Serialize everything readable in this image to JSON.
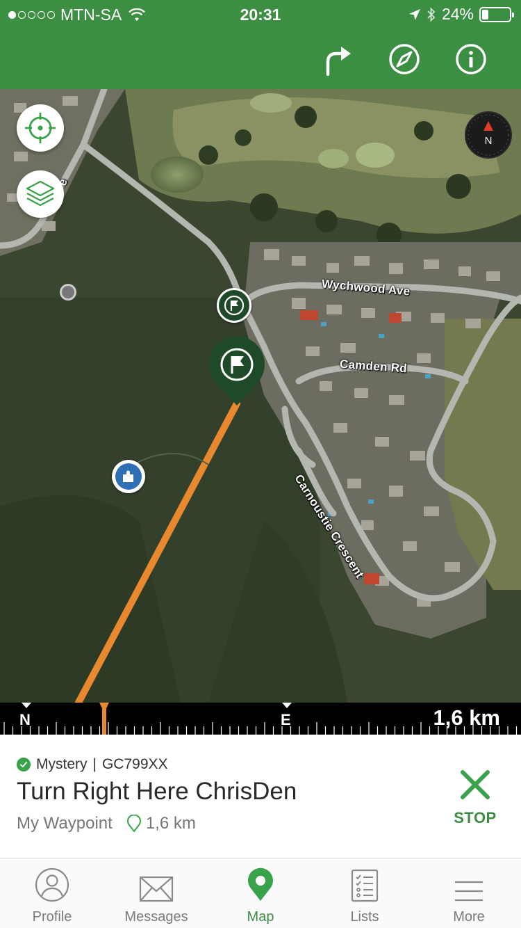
{
  "status_bar": {
    "carrier": "MTN-SA",
    "time": "20:31",
    "battery": "24%",
    "battery_level": 0.24,
    "signal_bars_filled": 1,
    "signal_bars_total": 5,
    "icons": [
      "wifi-icon",
      "location-arrow-icon",
      "bluetooth-icon"
    ]
  },
  "header": {
    "background_color": "#3c8e43",
    "actions": [
      "directions-icon",
      "compass-icon",
      "info-icon"
    ]
  },
  "map": {
    "road_labels": {
      "wychwood": "Wychwood Ave",
      "camden": "Camden Rd",
      "carnoustie": "Carnoustie Crescent",
      "edge_fragment": "e"
    },
    "compass_label": "N",
    "route_color": "#e8892f",
    "controls": [
      "locate-icon",
      "layers-icon"
    ]
  },
  "heading_strip": {
    "north": "N",
    "east": "E",
    "distance": "1,6 km"
  },
  "cache": {
    "type": "Mystery",
    "separator": "|",
    "code": "GC799XX",
    "name": "Turn Right Here ChrisDen",
    "waypoint_label": "My Waypoint",
    "distance": "1,6 km",
    "stop_label": "STOP"
  },
  "tabs": [
    {
      "label": "Profile",
      "icon": "profile-icon",
      "active": false
    },
    {
      "label": "Messages",
      "icon": "envelope-icon",
      "active": false
    },
    {
      "label": "Map",
      "icon": "map-pin-icon",
      "active": true
    },
    {
      "label": "Lists",
      "icon": "checklist-icon",
      "active": false
    },
    {
      "label": "More",
      "icon": "menu-icon",
      "active": false
    }
  ],
  "accent_color": "#3c8e43"
}
